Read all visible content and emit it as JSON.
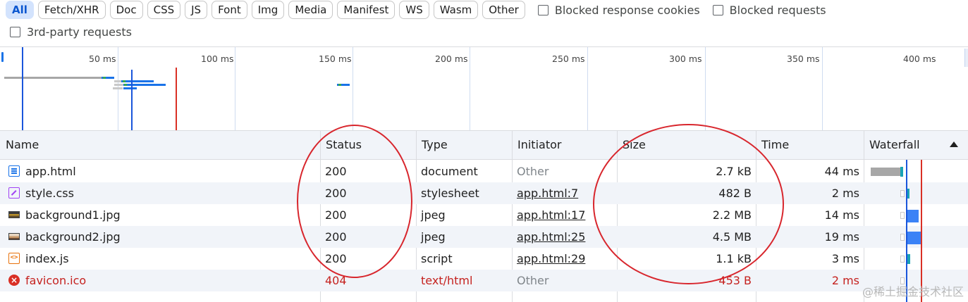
{
  "filters": {
    "chips": [
      "All",
      "Fetch/XHR",
      "Doc",
      "CSS",
      "JS",
      "Font",
      "Img",
      "Media",
      "Manifest",
      "WS",
      "Wasm",
      "Other"
    ],
    "active_chip": "All",
    "blocked_response_cookies": "Blocked response cookies",
    "blocked_requests": "Blocked requests",
    "third_party_requests": "3rd-party requests"
  },
  "overview": {
    "ticks": [
      "50 ms",
      "100 ms",
      "150 ms",
      "200 ms",
      "250 ms",
      "300 ms",
      "350 ms",
      "400 ms"
    ],
    "dom_content_loaded_color": "#1a56db",
    "load_color": "#d93025"
  },
  "table": {
    "headers": {
      "name": "Name",
      "status": "Status",
      "type": "Type",
      "initiator": "Initiator",
      "size": "Size",
      "time": "Time",
      "waterfall": "Waterfall"
    },
    "sorted_column": "waterfall",
    "rows": [
      {
        "name": "app.html",
        "icon": "document-icon",
        "status": "200",
        "type": "document",
        "initiator": "Other",
        "initiator_link": false,
        "size": "2.7 kB",
        "time": "44 ms",
        "error": false
      },
      {
        "name": "style.css",
        "icon": "stylesheet-icon",
        "status": "200",
        "type": "stylesheet",
        "initiator": "app.html:7",
        "initiator_link": true,
        "size": "482 B",
        "time": "2 ms",
        "error": false
      },
      {
        "name": "background1.jpg",
        "icon": "image-icon",
        "status": "200",
        "type": "jpeg",
        "initiator": "app.html:17",
        "initiator_link": true,
        "size": "2.2 MB",
        "time": "14 ms",
        "error": false
      },
      {
        "name": "background2.jpg",
        "icon": "image-icon",
        "status": "200",
        "type": "jpeg",
        "initiator": "app.html:25",
        "initiator_link": true,
        "size": "4.5 MB",
        "time": "19 ms",
        "error": false
      },
      {
        "name": "index.js",
        "icon": "script-icon",
        "status": "200",
        "type": "script",
        "initiator": "app.html:29",
        "initiator_link": true,
        "size": "1.1 kB",
        "time": "3 ms",
        "error": false
      },
      {
        "name": "favicon.ico",
        "icon": "error-icon",
        "status": "404",
        "type": "text/html",
        "initiator": "Other",
        "initiator_link": false,
        "size": "453 B",
        "time": "2 ms",
        "error": true
      }
    ]
  },
  "watermark": "@稀土掘金技术社区",
  "annotation_color": "#d8262d"
}
